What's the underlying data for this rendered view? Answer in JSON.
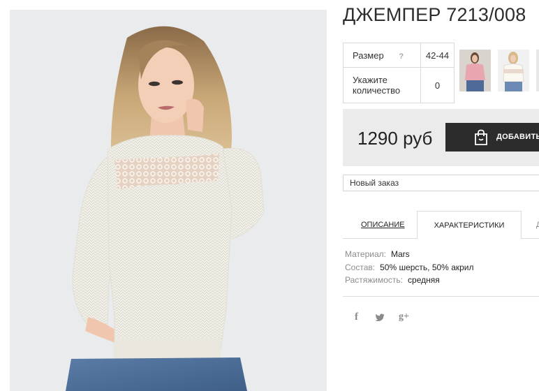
{
  "product": {
    "title": "ДЖЕМПЕР 7213/008",
    "image": "product-photo-woman-white-knit-sweater-with-lace-yoke"
  },
  "size_table": {
    "size_label": "Размер",
    "size_help": "?",
    "size_value": "42-44",
    "qty_label_line1": "Укажите",
    "qty_label_line2": "количество",
    "qty_value": "0"
  },
  "thumbnails": [
    "pink-sweater-thumbnail",
    "white-sweater-thumbnail"
  ],
  "price": {
    "value": "1290 руб",
    "add_label": "ДОБАВИТЬ"
  },
  "order": {
    "selected": "Новый заказ"
  },
  "tabs": [
    {
      "label": "ОПИСАНИЕ",
      "active": false
    },
    {
      "label": "ХАРАКТЕРИСТИКИ",
      "active": true
    },
    {
      "label": "Д",
      "active": false
    }
  ],
  "specs": [
    {
      "key": "Материал:",
      "value": "Mars"
    },
    {
      "key": "Состав:",
      "value": "50% шерсть, 50% акрил"
    },
    {
      "key": "Растяжимость:",
      "value": "средняя"
    }
  ],
  "social": {
    "facebook": "f",
    "twitter": "twitter-icon",
    "googleplus": "g+"
  },
  "colors": {
    "button_bg": "#2c2c2c",
    "price_bg": "#ebebeb",
    "photo_bg": "#e9ebed"
  }
}
